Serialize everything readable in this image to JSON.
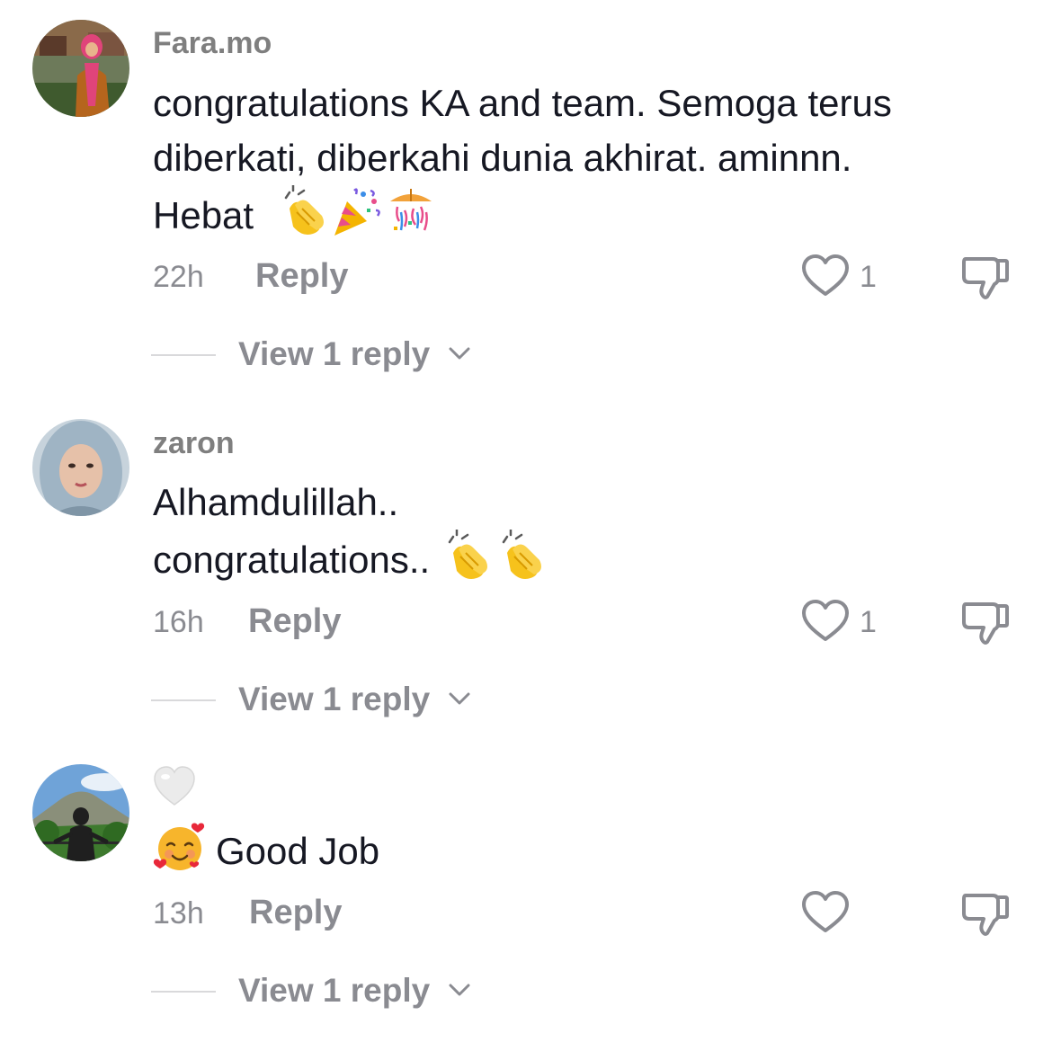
{
  "comments": [
    {
      "username": "Fara.mo",
      "lines": [
        "congratulations KA and team. Semoga terus",
        "diberkati, diberkahi dunia akhirat. aminnn.",
        "Hebat"
      ],
      "emojis": [
        "clapping-hands-emoji",
        "party-popper-emoji",
        "confetti-ball-emoji"
      ],
      "time": "22h",
      "reply_label": "Reply",
      "like_count": "1",
      "view_replies_label": "View 1 reply"
    },
    {
      "username": "zaron",
      "lines": [
        "Alhamdulillah..",
        "congratulations.."
      ],
      "emojis": [
        "clapping-hands-emoji",
        "clapping-hands-emoji"
      ],
      "time": "16h",
      "reply_label": "Reply",
      "like_count": "1",
      "view_replies_label": "View 1 reply"
    },
    {
      "username_emoji": "white-heart-emoji",
      "lines": [
        "Good Job"
      ],
      "emojis": [
        "smiling-face-with-hearts-emoji"
      ],
      "time": "13h",
      "reply_label": "Reply",
      "like_count": "",
      "view_replies_label": "View 1 reply"
    }
  ],
  "colors": {
    "text_primary": "#161823",
    "text_secondary": "#8a8b91",
    "username": "#7f7f7f",
    "divider": "#d9d9db"
  },
  "icons": {
    "like": "heart-outline-icon",
    "dislike": "thumbs-down-outline-icon",
    "expand": "chevron-down-icon"
  }
}
